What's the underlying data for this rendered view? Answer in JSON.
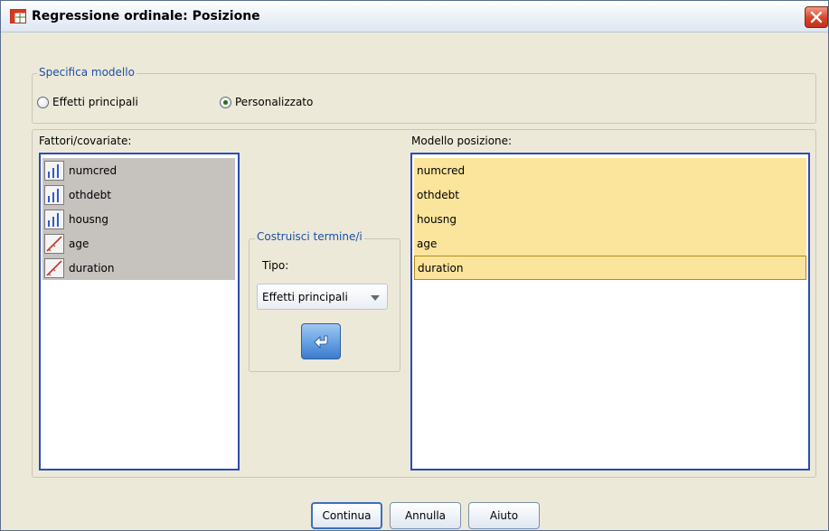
{
  "window": {
    "title": "Regressione ordinale: Posizione"
  },
  "model_spec": {
    "legend": "Specifica modello",
    "options": [
      {
        "label": "Effetti principali",
        "selected": false
      },
      {
        "label": "Personalizzato",
        "selected": true
      }
    ]
  },
  "factors": {
    "label": "Fattori/covariate:",
    "items": [
      {
        "name": "numcred",
        "icon": "ordinal-variable-icon"
      },
      {
        "name": "othdebt",
        "icon": "ordinal-variable-icon"
      },
      {
        "name": "housng",
        "icon": "ordinal-variable-icon"
      },
      {
        "name": "age",
        "icon": "scale-variable-icon"
      },
      {
        "name": "duration",
        "icon": "scale-variable-icon"
      }
    ]
  },
  "build_terms": {
    "legend": "Costruisci termine/i",
    "type_label": "Tipo:",
    "type_value": "Effetti principali",
    "move_button_icon": "arrow-move-icon"
  },
  "model": {
    "label": "Modello posizione:",
    "items": [
      "numcred",
      "othdebt",
      "housng",
      "age",
      "duration"
    ]
  },
  "buttons": {
    "continue": "Continua",
    "cancel": "Annulla",
    "help": "Aiuto"
  },
  "colors": {
    "dialog_bg": "#ECE9D8",
    "selection_gray": "#c6c3bf",
    "selection_yellow": "#fbe49b",
    "list_border": "#2c4bb7",
    "legend_text": "#1c4fa8"
  }
}
